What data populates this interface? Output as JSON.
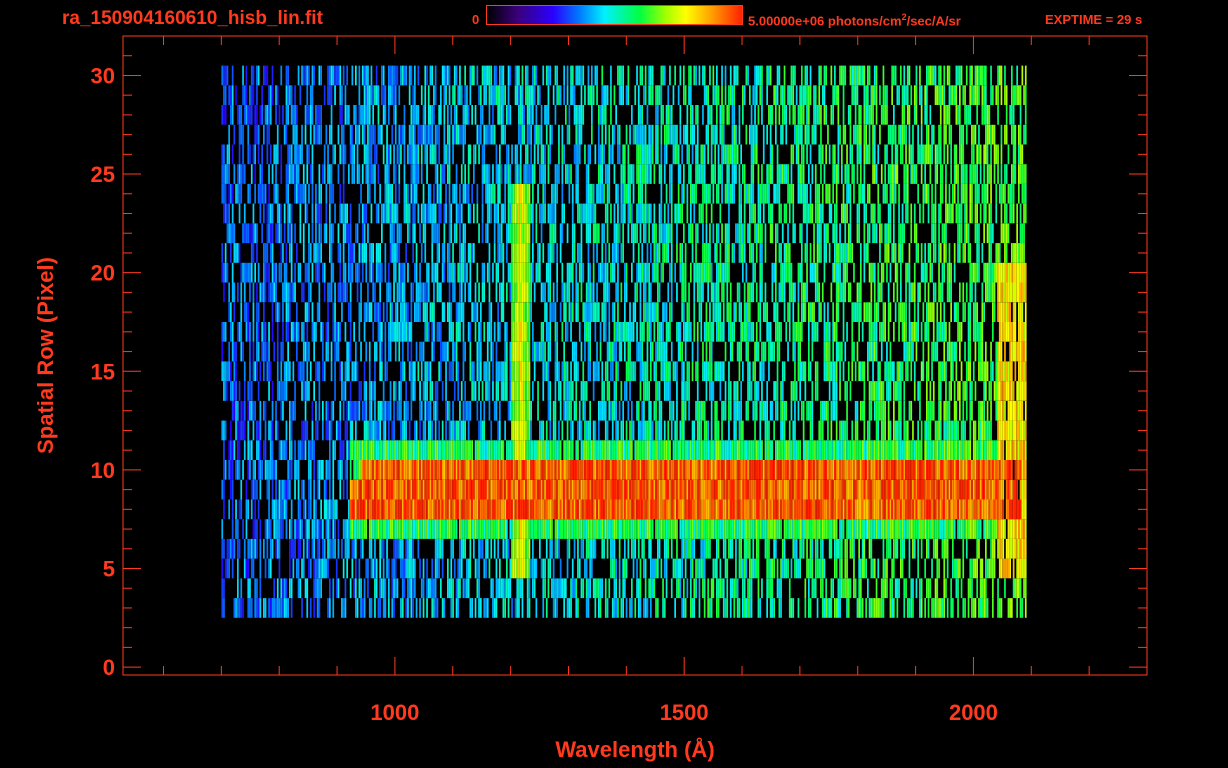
{
  "header": {
    "file_title": "ra_150904160610_hisb_lin.fit",
    "colorbar_min": "0",
    "colorbar_max_value": "5.00000e+06",
    "colorbar_units_before": " photons/cm",
    "colorbar_units_sup": "2",
    "colorbar_units_after": "/sec/A/sr",
    "exptime": "EXPTIME = 29 s"
  },
  "colors": {
    "axis": "#ff3a1f",
    "background": "#000000"
  },
  "chart_data": {
    "type": "heatmap",
    "title": "",
    "xlabel": "Wavelength (Å)",
    "ylabel": "Spatial Row (Pixel)",
    "xlim": [
      530,
      2300
    ],
    "ylim": [
      -0.4,
      32
    ],
    "x_ticks": [
      1000,
      1500,
      2000
    ],
    "y_ticks": [
      0,
      5,
      10,
      15,
      20,
      25,
      30
    ],
    "colorscale": [
      "#000000",
      "#3a007a",
      "#2a00ff",
      "#0078ff",
      "#00f0ff",
      "#00ff40",
      "#a0ff00",
      "#ffff00",
      "#ffa000",
      "#ff2000"
    ],
    "colorbar_range": [
      0,
      5000000
    ],
    "spatial_rows": [
      3,
      30
    ],
    "wavelength_range": [
      700,
      2090
    ],
    "features": [
      {
        "kind": "horizontal_band",
        "rows": [
          8,
          10
        ],
        "wavelength_range": [
          920,
          2080
        ],
        "level": 0.95
      },
      {
        "kind": "horizontal_band",
        "rows": [
          7,
          11
        ],
        "wavelength_range": [
          920,
          2080
        ],
        "level": 0.55
      },
      {
        "kind": "vertical_line",
        "wavelength": 1216,
        "rows": [
          5,
          24
        ],
        "level": 0.75
      }
    ]
  }
}
